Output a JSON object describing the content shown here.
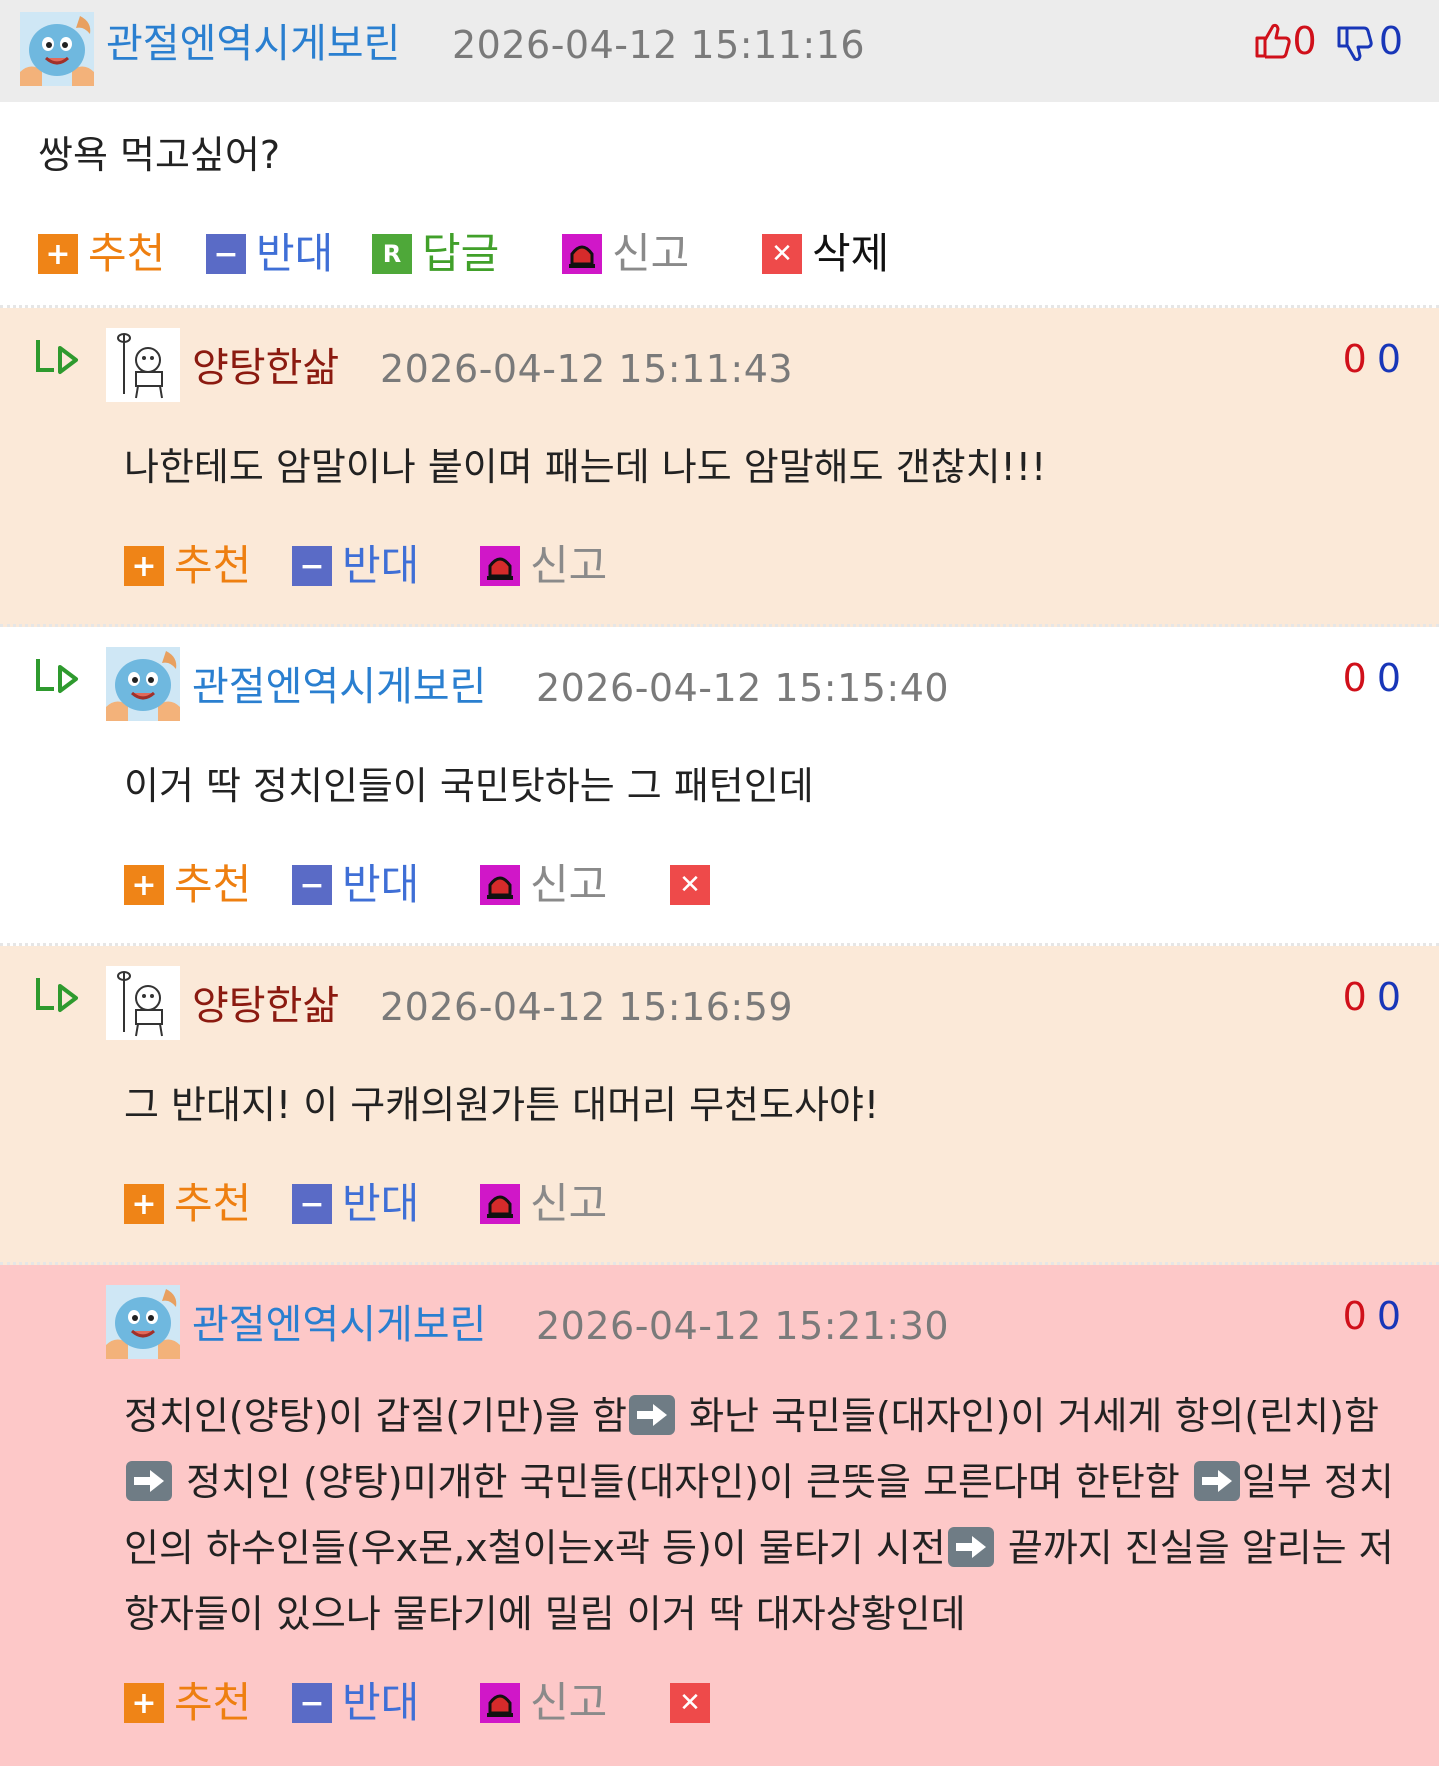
{
  "main_comment": {
    "author": "관절엔역시게보린",
    "timestamp": "2026-04-12 15:11:16",
    "likes": "0",
    "dislikes": "0",
    "text": "쌍욕 먹고싶어?",
    "actions": {
      "recommend": "추천",
      "oppose": "반대",
      "reply": "답글",
      "report": "신고",
      "delete": "삭제"
    }
  },
  "replies": [
    {
      "author": "양탕한삶",
      "timestamp": "2026-04-12 15:11:43",
      "likes": "0",
      "dislikes": "0",
      "text": "나한테도 암말이나 붙이며 패는데 나도 암말해도 갠찮치!!!",
      "actions": {
        "recommend": "추천",
        "oppose": "반대",
        "report": "신고"
      }
    },
    {
      "author": "관절엔역시게보린",
      "timestamp": "2026-04-12 15:15:40",
      "likes": "0",
      "dislikes": "0",
      "text": "이거 딱 정치인들이 국민탓하는 그 패턴인데",
      "actions": {
        "recommend": "추천",
        "oppose": "반대",
        "report": "신고"
      }
    },
    {
      "author": "양탕한삶",
      "timestamp": "2026-04-12 15:16:59",
      "likes": "0",
      "dislikes": "0",
      "text": "그 반대지! 이 구캐의원가튼 대머리 무천도사야!",
      "actions": {
        "recommend": "추천",
        "oppose": "반대",
        "report": "신고"
      }
    },
    {
      "author": "관절엔역시게보린",
      "timestamp": "2026-04-12 15:21:30",
      "likes": "0",
      "dislikes": "0",
      "text_parts": [
        "정치인(양탕)이 갑질(기만)을 함",
        " 화난 국민들(대자인)이 거세게 항의(린치)함",
        " 정치인 (양탕)미개한 국민들(대자인)이 큰뜻을 모른다며 한탄함",
        "일부 정치인의 하수인들(우x몬,x철이는x곽 등)이 물타기 시전",
        " 끝까지 진실을 알리는 저항자들이 있으나 물타기에 밀림 이거 딱 대자상황인데"
      ],
      "actions": {
        "recommend": "추천",
        "oppose": "반대",
        "report": "신고"
      }
    }
  ],
  "colors": {
    "main_header_bg": "#ececec",
    "reply_bg_peach": "#fbe9d8",
    "reply_bg_white": "#ffffff",
    "reply_bg_pink": "#fdc8c8",
    "author_blue": "#2a7fd0",
    "author_red": "#8b1a10",
    "like_red": "#d0101a",
    "dislike_blue": "#1836b8"
  },
  "icons": {
    "reply_indent": "reply-arrow-icon",
    "like": "thumbs-up-icon",
    "dislike": "thumbs-down-icon",
    "recommend": "plus-icon",
    "oppose": "minus-icon",
    "reply": "reply-r-icon",
    "report": "siren-icon",
    "delete": "close-icon"
  }
}
